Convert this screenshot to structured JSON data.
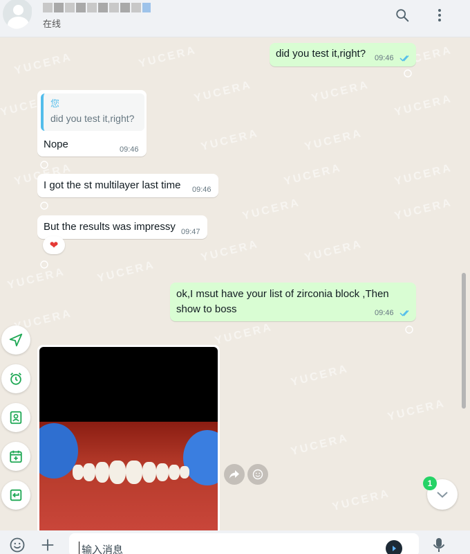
{
  "header": {
    "contact_status": "在线",
    "icons": [
      "search-icon",
      "more-vertical-icon"
    ]
  },
  "watermark": "YUCERA",
  "messages": [
    {
      "direction": "out",
      "text": "did you test it,right?",
      "time": "09:46",
      "status": "read"
    },
    {
      "direction": "in",
      "quote_author": "您",
      "quote_text": "did you test it,right?",
      "text": "Nope",
      "time": "09:46"
    },
    {
      "direction": "in",
      "text": "I got the st multilayer last time",
      "time": "09:46"
    },
    {
      "direction": "in",
      "text": "But the results was impressy",
      "time": "09:47",
      "reaction": "❤"
    },
    {
      "direction": "out",
      "text_line1": "ok,I msut have your list of zirconia block ,Then",
      "text_line2": "show to boss",
      "time": "09:46",
      "status": "read"
    },
    {
      "direction": "in",
      "type": "image",
      "image": "dental-photo"
    }
  ],
  "tools": [
    "send-icon",
    "alarm-clock-icon",
    "contact-card-icon",
    "calendar-plus-icon",
    "reply-icon"
  ],
  "scroll_down": {
    "unread_count": "1"
  },
  "composer": {
    "placeholder": "输入消息",
    "icons": [
      "emoji-icon",
      "plus-icon",
      "ai-icon",
      "microphone-icon"
    ]
  },
  "colors": {
    "outgoing_bubble": "#d9fdd3",
    "incoming_bubble": "#ffffff",
    "chat_background": "#efeae2",
    "tick_read": "#53bdeb",
    "accent_green": "#25d366"
  }
}
